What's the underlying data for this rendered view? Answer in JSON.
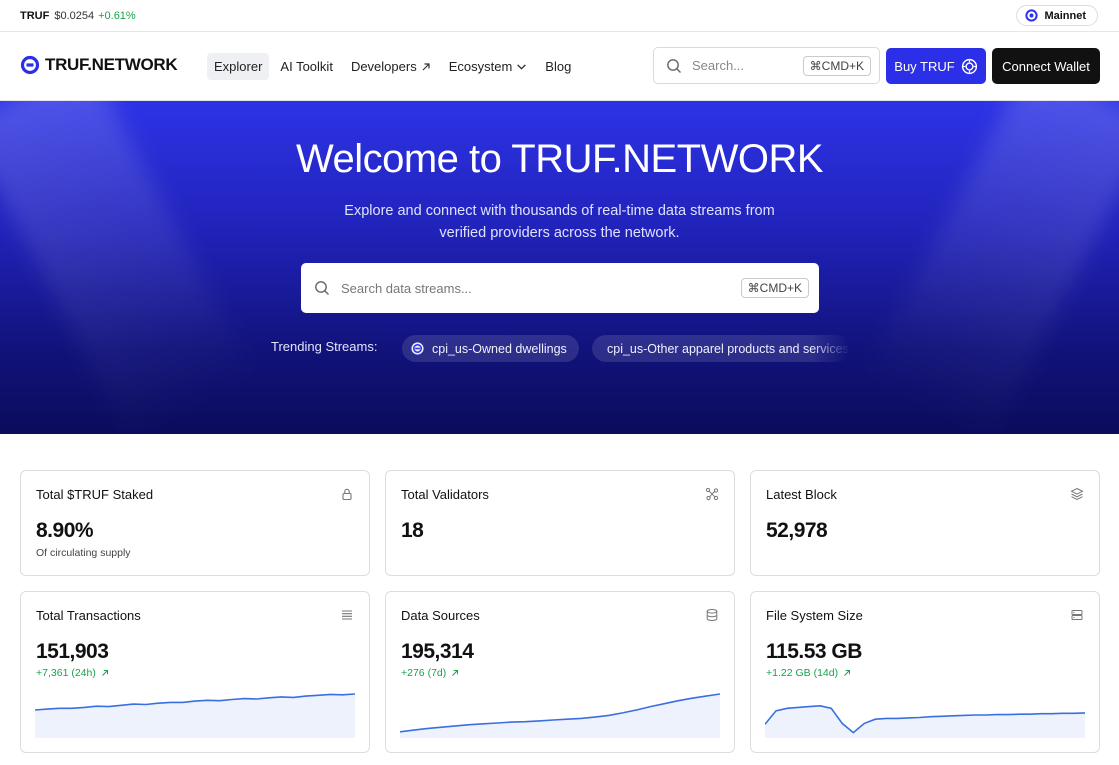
{
  "ticker": {
    "symbol": "TRUF",
    "price": "$0.0254",
    "change": "+0.61%"
  },
  "network": {
    "label": "Mainnet"
  },
  "brand": {
    "name": "TRUF.NETWORK"
  },
  "nav": {
    "items": [
      {
        "label": "Explorer"
      },
      {
        "label": "AI Toolkit"
      },
      {
        "label": "Developers"
      },
      {
        "label": "Ecosystem"
      },
      {
        "label": "Blog"
      }
    ]
  },
  "header_search": {
    "placeholder": "Search...",
    "shortcut": "⌘CMD+K"
  },
  "buttons": {
    "buy": "Buy TRUF",
    "connect": "Connect Wallet"
  },
  "hero": {
    "title": "Welcome to TRUF.NETWORK",
    "subtitle": "Explore and connect with thousands of real-time data streams from verified providers across the network.",
    "search_placeholder": "Search data streams...",
    "search_shortcut": "⌘CMD+K",
    "trending_label": "Trending Streams:",
    "trending": [
      {
        "label": "cpi_us-Owned dwellings"
      },
      {
        "label": "cpi_us-Other apparel products and services"
      }
    ]
  },
  "stats": [
    {
      "title": "Total $TRUF Staked",
      "value": "8.90%",
      "sub": "Of circulating supply",
      "icon": "lock-icon"
    },
    {
      "title": "Total Validators",
      "value": "18",
      "icon": "network-nodes-icon"
    },
    {
      "title": "Latest Block",
      "value": "52,978",
      "icon": "layers-icon"
    },
    {
      "title": "Total Transactions",
      "value": "151,903",
      "delta": "+7,361 (24h)",
      "icon": "list-icon",
      "trend": [
        0.62,
        0.64,
        0.66,
        0.66,
        0.68,
        0.71,
        0.7,
        0.73,
        0.76,
        0.75,
        0.78,
        0.8,
        0.8,
        0.83,
        0.85,
        0.84,
        0.87,
        0.89,
        0.88,
        0.91,
        0.93,
        0.92,
        0.95,
        0.97,
        0.99,
        0.98,
        1.0
      ]
    },
    {
      "title": "Data Sources",
      "value": "195,314",
      "delta": "+276 (7d)",
      "icon": "database-icon",
      "trend": [
        0.1,
        0.14,
        0.18,
        0.21,
        0.24,
        0.27,
        0.29,
        0.31,
        0.33,
        0.34,
        0.36,
        0.38,
        0.4,
        0.42,
        0.45,
        0.49,
        0.55,
        0.62,
        0.7,
        0.77,
        0.84,
        0.9,
        0.95,
        1.0
      ]
    },
    {
      "title": "File System Size",
      "value": "115.53 GB",
      "delta": "+1.22 GB (14d)",
      "icon": "server-icon",
      "trend": [
        0.28,
        0.6,
        0.66,
        0.68,
        0.7,
        0.72,
        0.66,
        0.3,
        0.08,
        0.3,
        0.4,
        0.42,
        0.42,
        0.43,
        0.44,
        0.46,
        0.47,
        0.48,
        0.49,
        0.5,
        0.5,
        0.51,
        0.51,
        0.52,
        0.52,
        0.53,
        0.53,
        0.54,
        0.54,
        0.55
      ]
    }
  ]
}
